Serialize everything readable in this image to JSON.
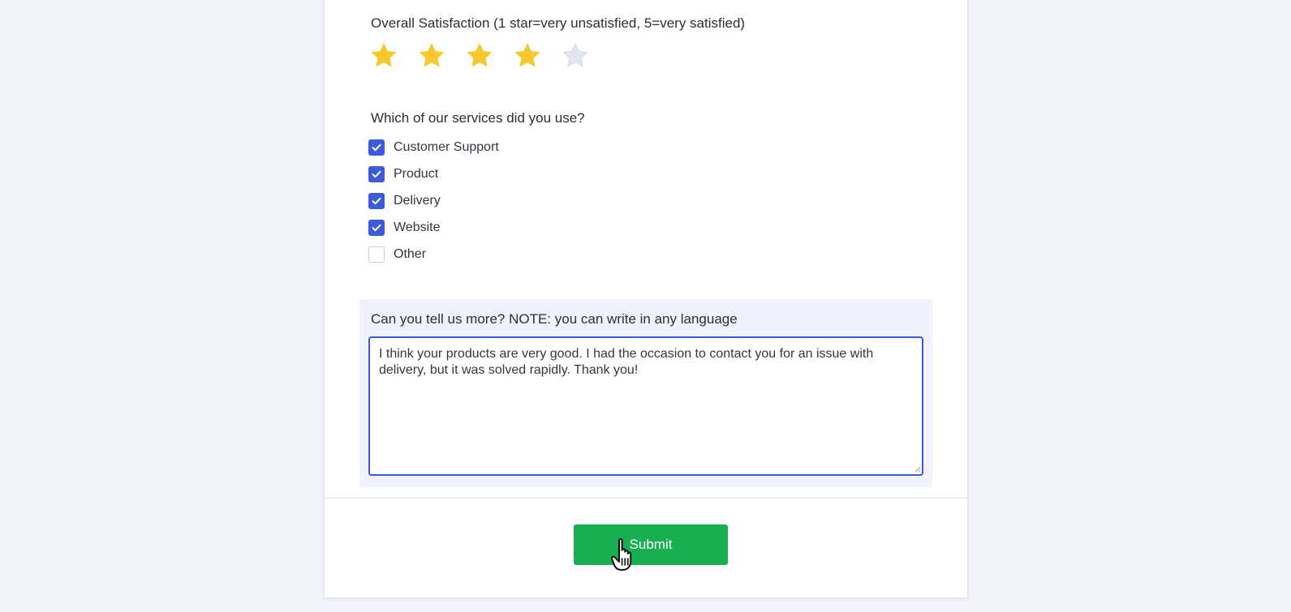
{
  "rating": {
    "title": "Overall Satisfaction (1 star=very unsatisfied, 5=very satisfied)",
    "max_stars": 5,
    "selected": 4,
    "filled_color": "#f7c92f",
    "empty_color": "#e3e5f2"
  },
  "services": {
    "title": "Which of our services did you use?",
    "options": [
      {
        "label": "Customer Support",
        "checked": true
      },
      {
        "label": "Product",
        "checked": true
      },
      {
        "label": "Delivery",
        "checked": true
      },
      {
        "label": "Website",
        "checked": true
      },
      {
        "label": "Other",
        "checked": false
      }
    ]
  },
  "comment": {
    "title": "Can you tell us more? NOTE: you can write in any language",
    "value": "I think your products are very good. I had the occasion to contact you for an issue with delivery, but it was solved rapidly. Thank you!"
  },
  "footer": {
    "submit_label": "Submit"
  },
  "colors": {
    "accent": "#3b5bdb",
    "submit": "#1aae52"
  },
  "icons": {
    "star": "star-icon",
    "check": "check-icon",
    "cursor": "hand-pointer-icon"
  }
}
